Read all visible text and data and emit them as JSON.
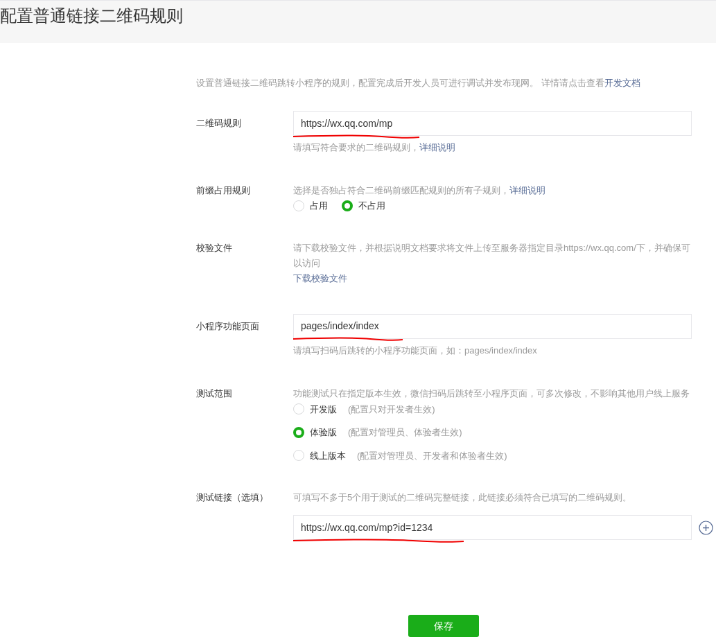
{
  "page": {
    "title": "配置普通链接二维码规则"
  },
  "intro": {
    "text": "设置普通链接二维码跳转小程序的规则，配置完成后开发人员可进行调试并发布现网。 详情请点击查看",
    "link": "开发文档"
  },
  "rows": [
    {
      "kind": "input",
      "label": "二维码规则",
      "value": "https://wx.qq.com/mp",
      "hint": "请填写符合要求的二维码规则，",
      "hint_link": "详细说明"
    },
    {
      "kind": "radio",
      "label": "前缀占用规则",
      "hint": "选择是否独占符合二维码前缀匹配规则的所有子规则，",
      "hint_link": "详细说明",
      "options": [
        {
          "label": "占用",
          "selected": false
        },
        {
          "label": "不占用",
          "selected": true
        }
      ]
    },
    {
      "kind": "file",
      "label": "校验文件",
      "hint": "请下载校验文件，并根据说明文档要求将文件上传至服务器指定目录https://wx.qq.com/下，并确保可以访问",
      "link": "下载校验文件"
    },
    {
      "kind": "input",
      "label": "小程序功能页面",
      "value": "pages/index/index",
      "hint": "请填写扫码后跳转的小程序功能页面，如：pages/index/index"
    },
    {
      "kind": "radiolist",
      "label": "测试范围",
      "hint": "功能测试只在指定版本生效，微信扫码后跳转至小程序页面，可多次修改，不影响其他用户线上服务",
      "options": [
        {
          "label": "开发版",
          "note": "(配置只对开发者生效)",
          "selected": false
        },
        {
          "label": "体验版",
          "note": "(配置对管理员、体验者生效)",
          "selected": true
        },
        {
          "label": "线上版本",
          "note": "(配置对管理员、开发者和体验者生效)",
          "selected": false
        }
      ]
    },
    {
      "kind": "links",
      "label": "测试链接（选填）",
      "hint": "可填写不多于5个用于测试的二维码完整链接，此链接必须符合已填写的二维码规则。",
      "value": "https://wx.qq.com/mp?id=1234"
    }
  ],
  "save_button": "保存"
}
